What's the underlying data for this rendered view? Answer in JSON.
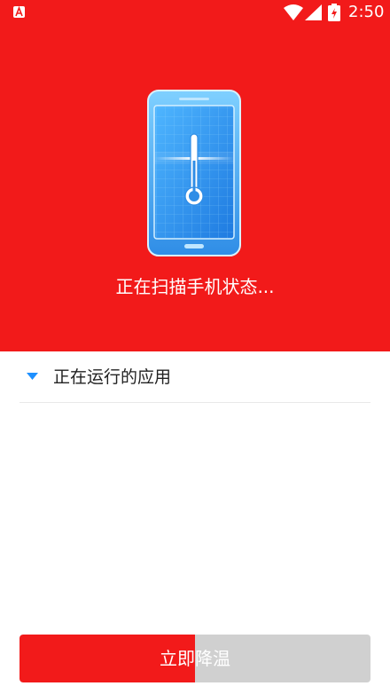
{
  "status_bar": {
    "time": "2:50",
    "icons": [
      "app-notification-icon",
      "wifi-icon",
      "signal-icon",
      "battery-charging-icon"
    ]
  },
  "hero": {
    "background_color": "#f21a1a",
    "illustration": "phone-thermometer-icon",
    "scan_text": "正在扫描手机状态..."
  },
  "running_apps": {
    "header_label": "正在运行的应用",
    "expand_icon": "caret-down-icon",
    "accent_color": "#1e90ff",
    "items": []
  },
  "action": {
    "label": "立即降温",
    "progress_fraction": 0.5,
    "progress_color": "#f21a1a",
    "track_color": "#d0d0d0"
  }
}
